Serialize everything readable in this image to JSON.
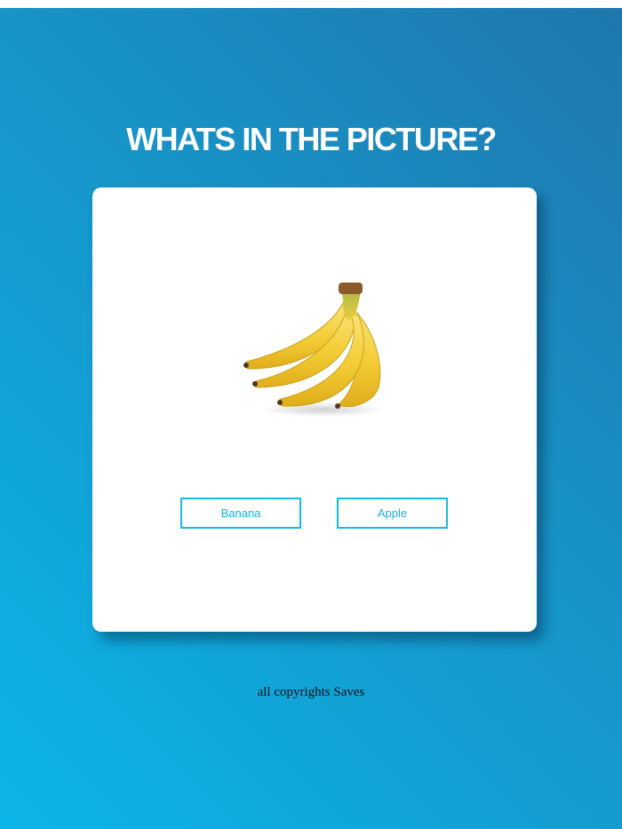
{
  "title": "WHATS IN THE PICTURE?",
  "card": {
    "image": {
      "subject": "banana-bunch"
    },
    "answers": [
      {
        "label": "Banana"
      },
      {
        "label": "Apple"
      }
    ]
  },
  "footer": {
    "text": "all copyrights Saves"
  },
  "colors": {
    "background_start": "#0bb5e9",
    "background_end": "#1f77ad",
    "button_border": "#19b9e6",
    "title": "#ffffff"
  }
}
